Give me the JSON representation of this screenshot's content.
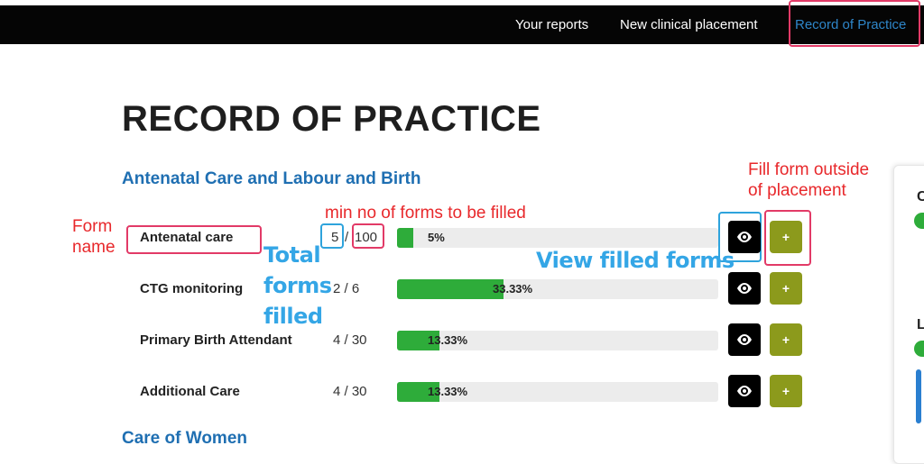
{
  "nav": {
    "items": [
      {
        "label": "Your reports"
      },
      {
        "label": "New clinical placement"
      },
      {
        "label": "Record of Practice",
        "active": true
      }
    ]
  },
  "page": {
    "title": "RECORD OF PRACTICE"
  },
  "sections": [
    {
      "heading": "Antenatal Care and Labour and Birth",
      "forms": [
        {
          "name": "Antenatal care",
          "filled": "5",
          "separator": "/",
          "min": "100",
          "progress_label": "5%",
          "progress": 0.05
        },
        {
          "name": "CTG monitoring",
          "count": "2 / 6",
          "progress_label": "33.33%",
          "progress": 0.3333
        },
        {
          "name": "Primary Birth Attendant",
          "count": "4 / 30",
          "progress_label": "13.33%",
          "progress": 0.1333
        },
        {
          "name": "Additional Care",
          "count": "4 / 30",
          "progress_label": "13.33%",
          "progress": 0.1333
        }
      ]
    },
    {
      "heading": "Care of Women",
      "forms": []
    }
  ],
  "buttons": {
    "view_icon": "eye-icon",
    "add_label": "+"
  },
  "annotations": {
    "form_name": "Form\nname",
    "min_forms": "min no of forms to be filled",
    "total_filled": "Total\nforms\nfilled",
    "view_forms": "View filled forms",
    "fill_outside": "Fill form outside\nof placement"
  },
  "side_panel": {
    "letters": [
      "C",
      "L"
    ]
  },
  "colors": {
    "nav_bg": "#050505",
    "active_link": "#2e86c9",
    "heading": "#1f6fb2",
    "progress": "#2eac3a",
    "add_button": "#8c9a1c",
    "annotation_red": "#e8282b",
    "annotation_blue": "#34a6e6"
  }
}
